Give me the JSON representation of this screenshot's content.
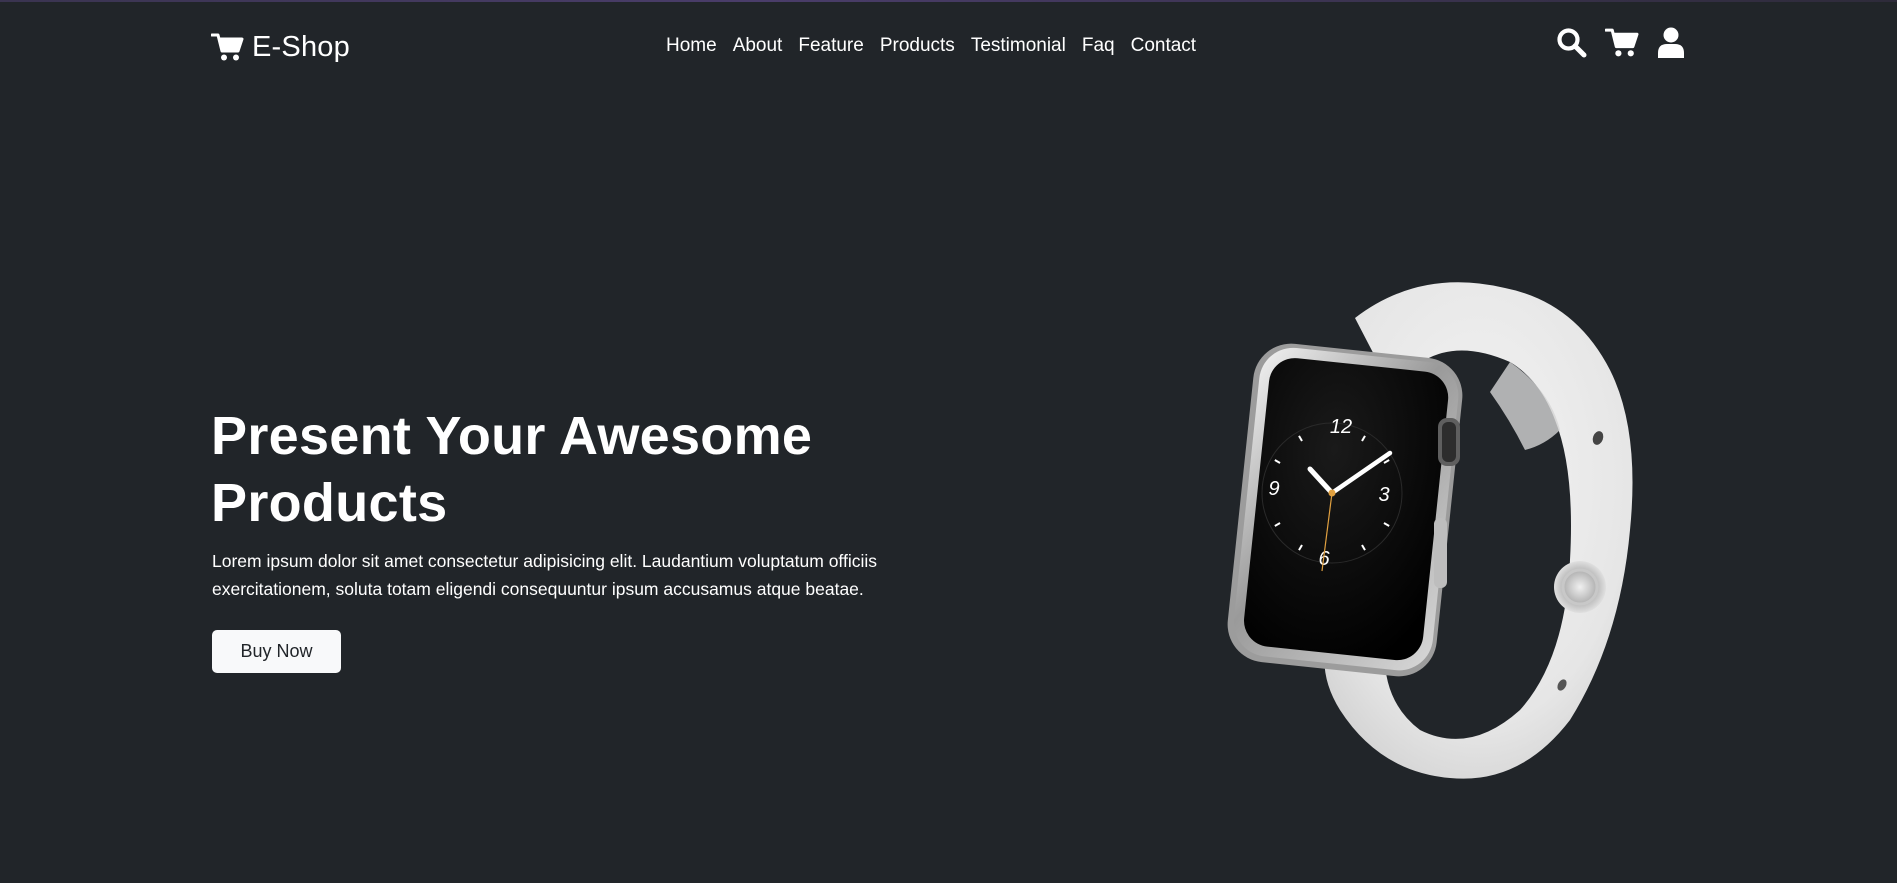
{
  "brand": {
    "name": "E-Shop",
    "icon": "cart-icon"
  },
  "nav": {
    "links": [
      "Home",
      "About",
      "Feature",
      "Products",
      "Testimonial",
      "Faq",
      "Contact"
    ],
    "icons": [
      "search-icon",
      "cart-icon",
      "user-icon"
    ]
  },
  "hero": {
    "title": "Present Your Awesome Products",
    "text": "Lorem ipsum dolor sit amet consectetur adipisicing elit. Laudantium voluptatum officiis exercitationem, soluta totam eligendi consequuntur ipsum accusamus atque beatae.",
    "button_label": "Buy Now",
    "image": "smartwatch-image",
    "watch_numerals": {
      "top": "12",
      "right": "3",
      "bottom": "6",
      "left": "9"
    }
  },
  "colors": {
    "background": "#212529",
    "text": "#ffffff",
    "button_bg": "#f8f9fa",
    "button_text": "#212529"
  }
}
